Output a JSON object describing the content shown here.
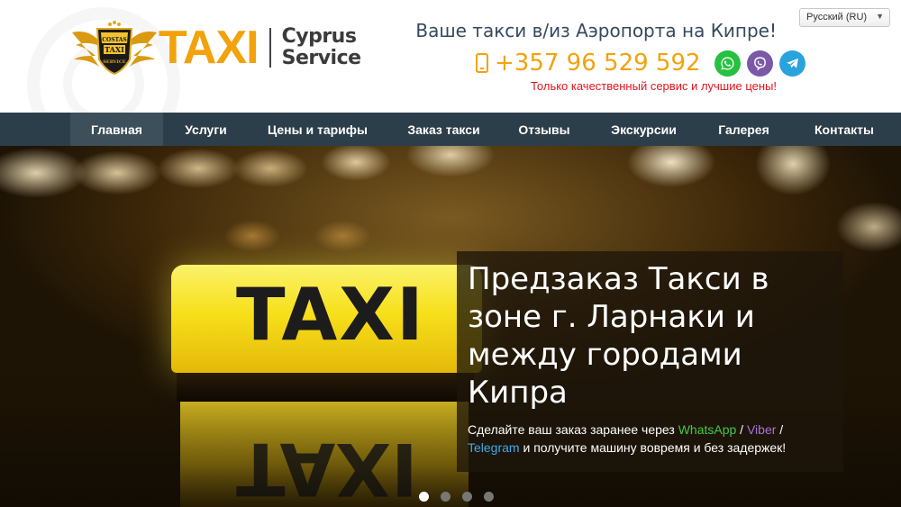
{
  "header": {
    "logo_word": "TAXI",
    "logo_sub_line1": "Cyprus",
    "logo_sub_line2": "Service",
    "emblem_text_top": "COSTAS",
    "emblem_text_mid": "TAXI",
    "emblem_text_bottom": "SERVICE",
    "tagline": "Ваше такси в/из Аэропорта на Кипре!",
    "phone": "+357 96 529 592",
    "promo": "Только качественный сервис и лучшие цены!",
    "language_selected": "Русский (RU)",
    "messengers": [
      {
        "name": "whatsapp-icon",
        "color": "#25c13f"
      },
      {
        "name": "viber-icon",
        "color": "#7b58a8"
      },
      {
        "name": "telegram-icon",
        "color": "#2aa3dd"
      }
    ]
  },
  "nav": {
    "items": [
      {
        "label": "Главная",
        "active": true
      },
      {
        "label": "Услуги",
        "active": false
      },
      {
        "label": "Цены и тарифы",
        "active": false
      },
      {
        "label": "Заказ такси",
        "active": false
      },
      {
        "label": "Отзывы",
        "active": false
      },
      {
        "label": "Экскурсии",
        "active": false
      },
      {
        "label": "Галерея",
        "active": false
      },
      {
        "label": "Контакты",
        "active": false
      }
    ]
  },
  "hero": {
    "sign_text": "TAXI",
    "caption_title": "Предзаказ Такси в зоне г. Ларнаки и между городами Кипра",
    "caption_text_before": "Сделайте ваш заказ заранее через ",
    "whatsapp": "WhatsApp",
    "sep1": " / ",
    "viber": "Viber",
    "sep2": " / ",
    "telegram": "Telegram",
    "caption_text_after": " и получите машину вовремя и без задержек!",
    "slides_total": 4,
    "slide_active": 1
  },
  "colors": {
    "brand_orange": "#f2a20c",
    "nav_bg": "#2c3e4a",
    "promo_red": "#e3131b"
  }
}
